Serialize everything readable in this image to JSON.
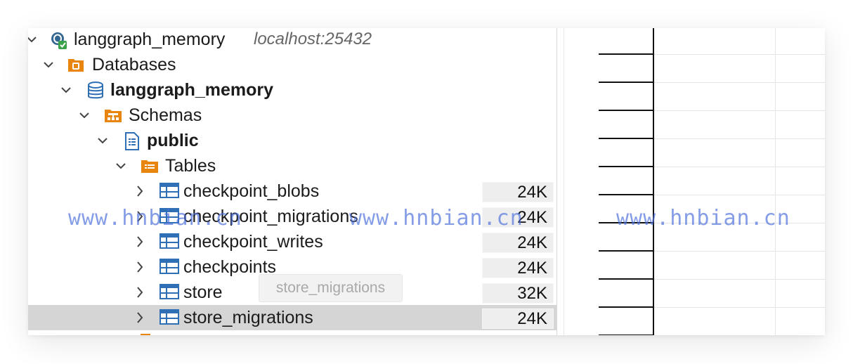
{
  "connection": {
    "name": "langgraph_memory",
    "host": "localhost:25432"
  },
  "tree": {
    "databases_label": "Databases",
    "database_name": "langgraph_memory",
    "schemas_label": "Schemas",
    "schema_name": "public",
    "tables_label": "Tables",
    "tables": [
      {
        "name": "checkpoint_blobs",
        "size": "24K"
      },
      {
        "name": "checkpoint_migrations",
        "size": "24K"
      },
      {
        "name": "checkpoint_writes",
        "size": "24K"
      },
      {
        "name": "checkpoints",
        "size": "24K"
      },
      {
        "name": "store",
        "size": "32K"
      },
      {
        "name": "store_migrations",
        "size": "24K"
      }
    ]
  },
  "tooltip": {
    "text": "store_migrations"
  },
  "watermark": {
    "text": "www.hnbian.cn"
  },
  "icons": {
    "connection": "postgres-elephant-icon",
    "databases": "databases-folder-icon",
    "database": "database-cylinder-icon",
    "schemas": "schemas-folder-icon",
    "schema": "schema-icon",
    "tables": "tables-folder-icon",
    "table": "table-icon"
  },
  "colors": {
    "orange": "#e8850f",
    "blue": "#2f6fb5",
    "selection": "#d5d5d5",
    "watermark": "#4b6edc"
  }
}
